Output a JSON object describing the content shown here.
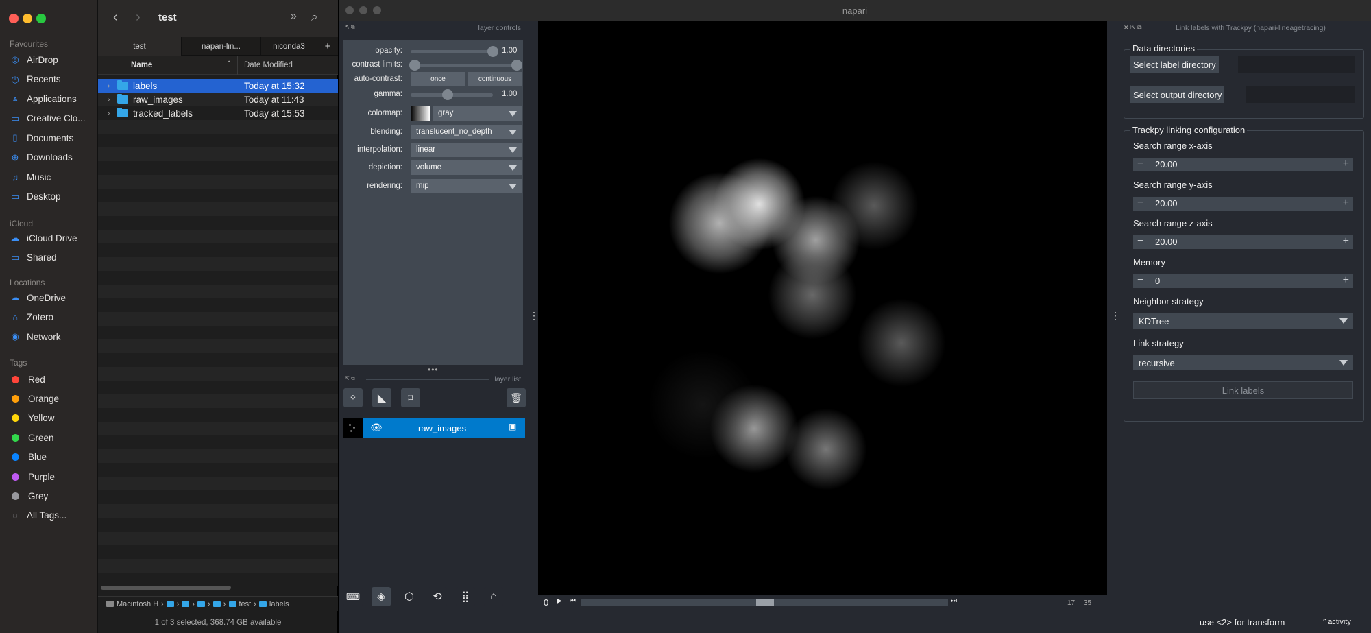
{
  "finder": {
    "title": "test",
    "sidebar": {
      "favourites_label": "Favourites",
      "favourites": [
        {
          "label": "AirDrop",
          "icon": "airdrop-icon",
          "glyph": "◎"
        },
        {
          "label": "Recents",
          "icon": "clock-icon",
          "glyph": "◷"
        },
        {
          "label": "Applications",
          "icon": "applications-icon",
          "glyph": "⩓"
        },
        {
          "label": "Creative Clo...",
          "icon": "folder-icon",
          "glyph": "▭"
        },
        {
          "label": "Documents",
          "icon": "document-icon",
          "glyph": "▯"
        },
        {
          "label": "Downloads",
          "icon": "download-icon",
          "glyph": "⊕"
        },
        {
          "label": "Music",
          "icon": "music-icon",
          "glyph": "♫"
        },
        {
          "label": "Desktop",
          "icon": "desktop-icon",
          "glyph": "▭"
        }
      ],
      "icloud_label": "iCloud",
      "icloud": [
        {
          "label": "iCloud Drive",
          "icon": "cloud-icon",
          "glyph": "☁"
        },
        {
          "label": "Shared",
          "icon": "shared-folder-icon",
          "glyph": "▭"
        }
      ],
      "locations_label": "Locations",
      "locations": [
        {
          "label": "OneDrive",
          "icon": "cloud-icon",
          "glyph": "☁"
        },
        {
          "label": "Zotero",
          "icon": "drive-icon",
          "glyph": "⌂"
        },
        {
          "label": "Network",
          "icon": "network-icon",
          "glyph": "◉"
        }
      ],
      "tags_label": "Tags",
      "tags": [
        {
          "label": "Red",
          "color": "#ff453a"
        },
        {
          "label": "Orange",
          "color": "#ff9f0a"
        },
        {
          "label": "Yellow",
          "color": "#ffd60a"
        },
        {
          "label": "Green",
          "color": "#32d74b"
        },
        {
          "label": "Blue",
          "color": "#0a84ff"
        },
        {
          "label": "Purple",
          "color": "#bf5af2"
        },
        {
          "label": "Grey",
          "color": "#98989d"
        }
      ],
      "all_tags": "All Tags..."
    },
    "tabs": [
      "test",
      "napari-lin...",
      "niconda3"
    ],
    "columns": {
      "name": "Name",
      "date": "Date Modified"
    },
    "rows": [
      {
        "name": "labels",
        "date": "Today at 15:32",
        "selected": true
      },
      {
        "name": "raw_images",
        "date": "Today at 11:43",
        "selected": false
      },
      {
        "name": "tracked_labels",
        "date": "Today at 15:53",
        "selected": false
      }
    ],
    "path": [
      "Macintosh H",
      "test",
      "labels"
    ],
    "status": "1 of 3 selected, 368.74 GB available"
  },
  "napari": {
    "window_title": "napari",
    "layer_controls_title": "layer controls",
    "layer_list_title": "layer list",
    "controls": {
      "opacity_label": "opacity:",
      "opacity_value": "1.00",
      "opacity": 1.0,
      "contrast_label": "contrast limits:",
      "autocontrast_label": "auto-contrast:",
      "once": "once",
      "continuous": "continuous",
      "gamma_label": "gamma:",
      "gamma_value": "1.00",
      "gamma": 0.45,
      "colormap_label": "colormap:",
      "colormap": "gray",
      "blending_label": "blending:",
      "blending": "translucent_no_depth",
      "interpolation_label": "interpolation:",
      "interpolation": "linear",
      "depiction_label": "depiction:",
      "depiction": "volume",
      "rendering_label": "rendering:",
      "rendering": "mip"
    },
    "layers": [
      {
        "name": "raw_images",
        "visible": true,
        "selected": true
      }
    ],
    "dims": {
      "current": "0",
      "slider_label": "17",
      "total": "35"
    },
    "status_text": "use <2> for transform",
    "activity": "activity"
  },
  "plugin": {
    "title": "Link labels with Trackpy (napari-lineagetracing)",
    "data_dirs_title": "Data directories",
    "select_label_dir": "Select label directory",
    "select_output_dir": "Select output directory",
    "config_title": "Trackpy linking configuration",
    "search_x_label": "Search range x-axis",
    "search_x": "20.00",
    "search_y_label": "Search range y-axis",
    "search_y": "20.00",
    "search_z_label": "Search range z-axis",
    "search_z": "20.00",
    "memory_label": "Memory",
    "memory": "0",
    "neighbor_label": "Neighbor strategy",
    "neighbor": "KDTree",
    "link_strategy_label": "Link strategy",
    "link_strategy": "recursive",
    "link_button": "Link labels"
  }
}
